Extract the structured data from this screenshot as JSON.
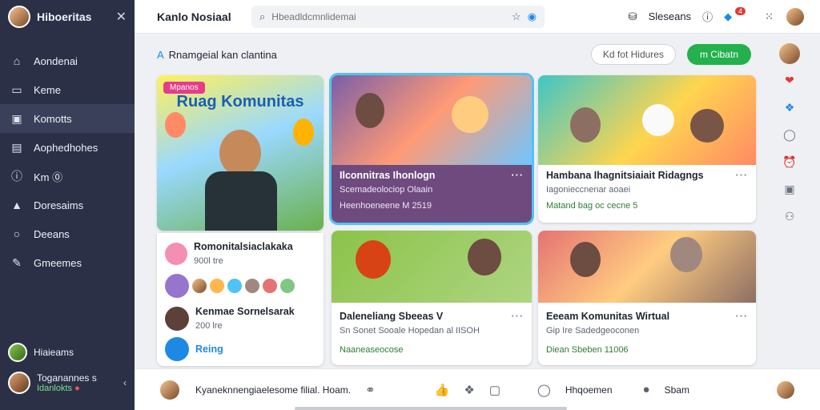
{
  "sidebar": {
    "title": "Hiboeritas",
    "items": [
      {
        "icon": "home-icon",
        "glyph": "⌂",
        "label": "Aondenai"
      },
      {
        "icon": "doc-icon",
        "glyph": "▭",
        "label": "Keme"
      },
      {
        "icon": "grid-icon",
        "glyph": "▣",
        "label": "Komotts"
      },
      {
        "icon": "chat-icon",
        "glyph": "▤",
        "label": "Aophedhohes"
      },
      {
        "icon": "info-icon",
        "glyph": "ⓘ",
        "label": "Km ⓪"
      },
      {
        "icon": "building-icon",
        "glyph": "▲",
        "label": "Doresaims"
      },
      {
        "icon": "search-icon",
        "glyph": "○",
        "label": "Deeans"
      },
      {
        "icon": "pen-icon",
        "glyph": "✎",
        "label": "Gmeemes"
      }
    ],
    "footer_label": "Hiaieams",
    "user": {
      "name": "Toganannes s",
      "status": "Idanlokts"
    }
  },
  "topbar": {
    "app_name": "Kanlo Nosiaal",
    "search_placeholder": "Hbeadldcmnlidemai",
    "right_label": "Sleseans",
    "notif_count": "4"
  },
  "page": {
    "heading": "Rnamgeial kan clantina",
    "ghost_button": "Kd fot Hidures",
    "primary_button": "m Cibatn"
  },
  "cards": [
    {
      "title": "Romonitalsiaclakaka",
      "sub": "900l tre",
      "banner": "Ruag Komunitas",
      "tag": "Mpanos"
    },
    {
      "title": "Ilconnitras Ihonlogn",
      "sub": "Scemadeolociop Olaain",
      "sub2": "Heenhoeneene M 2519"
    },
    {
      "title": "Hambana Ihagnitsiaiait Ridagngs",
      "sub": "Iagonieccnenar aoaei",
      "sub2": "Matand bag oc cecne 5"
    },
    {
      "title": "Kenmae Sornelsarak",
      "sub": "200 lre",
      "sub2": "Reing"
    },
    {
      "title": "Daleneliang Sbeeas V",
      "sub": "Sn Sonet Sooale Hopedan al IISOH",
      "sub2": "Naaneaseocose"
    },
    {
      "title": "Eeeam Komunitas Wirtual",
      "sub": "Gip Ire Sadedgeoconen",
      "sub2": "Diean Sbeben 11006"
    }
  ],
  "bottombar": {
    "text": "Kyaneknnengiaelesome filial. Hoam.",
    "right1": "Hhqoemen",
    "right2": "Sbam"
  }
}
